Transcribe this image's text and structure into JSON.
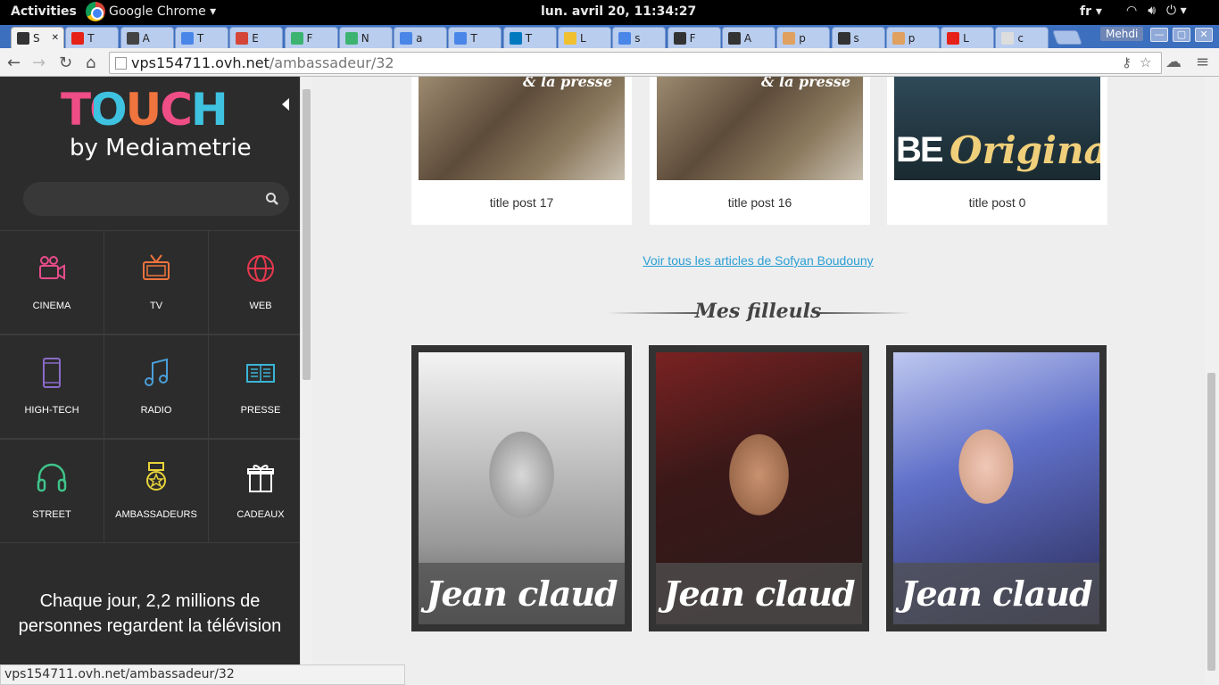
{
  "topbar": {
    "activities": "Activities",
    "app_name": "Google Chrome ▾",
    "clock": "lun. avril 20, 11:34:27",
    "lang": "fr ▾"
  },
  "browser": {
    "tabs": [
      "S",
      "T",
      "A",
      "T",
      "E",
      "F",
      "N",
      "a",
      "T",
      "T",
      "L",
      "s",
      "F",
      "A",
      "p",
      "s",
      "p",
      "L",
      "c"
    ],
    "user": "Mehdi",
    "url_host": "vps154711.ovh.net",
    "url_path": "/ambassadeur/32",
    "status_url": "vps154711.ovh.net/ambassadeur/32"
  },
  "sidebar": {
    "logo_touch": "TOUCH",
    "logo_by": "by Mediametrie",
    "categories": [
      {
        "label": "CINEMA",
        "icon": "camera-icon",
        "color": "#e84c8b"
      },
      {
        "label": "TV",
        "icon": "tv-icon",
        "color": "#f0743e"
      },
      {
        "label": "WEB",
        "icon": "globe-icon",
        "color": "#e8384f"
      },
      {
        "label": "HIGH-TECH",
        "icon": "phone-icon",
        "color": "#8a6bc8"
      },
      {
        "label": "RADIO",
        "icon": "music-icon",
        "color": "#4a9fd8"
      },
      {
        "label": "PRESSE",
        "icon": "newspaper-icon",
        "color": "#3ab5d8"
      },
      {
        "label": "STREET",
        "icon": "headphones-icon",
        "color": "#3fc48a"
      },
      {
        "label": "AMBASSADEURS",
        "icon": "medal-icon",
        "color": "#e8d43a"
      },
      {
        "label": "CADEAUX",
        "icon": "gift-icon",
        "color": "#ffffff"
      }
    ],
    "tagline": "Chaque jour, 2,2 millions de personnes regardent la télévision"
  },
  "main": {
    "posts": [
      {
        "title": "title post 17",
        "tag": "& la presse"
      },
      {
        "title": "title post 16",
        "tag": "& la presse"
      },
      {
        "title": "title post 0",
        "tag": "BE Original"
      }
    ],
    "view_all": "Voir tous les articles de Sofyan Boudouny",
    "filleuls_title": "Mes filleuls",
    "filleuls": [
      {
        "name": "Jean claud"
      },
      {
        "name": "Jean claud"
      },
      {
        "name": "Jean claud"
      }
    ]
  }
}
